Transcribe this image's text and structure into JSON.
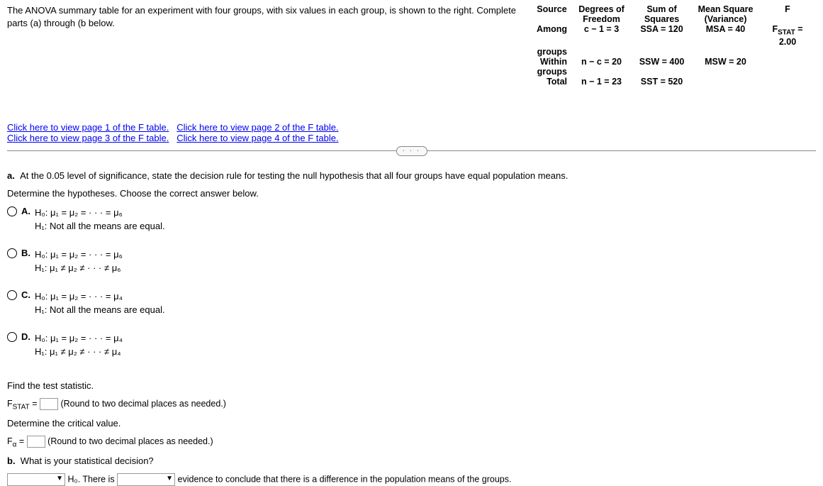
{
  "problem": {
    "intro": "The ANOVA summary table for an experiment with four groups, with six values in each group, is shown to the right. Complete parts (a) through (b below."
  },
  "anova": {
    "headers": {
      "source": "Source",
      "df": "Degrees of Freedom",
      "ss": "Sum of Squares",
      "ms": "Mean Square (Variance)",
      "f": "F"
    },
    "rows": {
      "among": {
        "src1": "Among",
        "src2": "groups",
        "df": "c − 1 = 3",
        "ss": "SSA = 120",
        "ms": "MSA = 40",
        "f_pre": "F",
        "f_sub": "STAT",
        "f_post": " = 2.00"
      },
      "within": {
        "src1": "Within",
        "src2": "groups",
        "df": "n − c = 20",
        "ss": "SSW = 400",
        "ms": "MSW = 20"
      },
      "total": {
        "src": "Total",
        "df": "n − 1 = 23",
        "ss": "SST = 520"
      }
    }
  },
  "links": {
    "p1": "Click here to view page 1 of the F table.",
    "p2": "Click here to view page 2 of the F table.",
    "p3": "Click here to view page 3 of the F table.",
    "p4": "Click here to view page 4 of the F table."
  },
  "dots": "· · ·",
  "partA": {
    "header": "At the 0.05 level of significance, state the decision rule for testing the null hypothesis that all four groups have equal population means.",
    "prompt": "Determine the hypotheses. Choose the correct answer below.",
    "options": {
      "A": {
        "letter": "A.",
        "l1": "H₀: μ₁ = μ₂ = · · · = μ₆",
        "l2": "H₁: Not all the means are equal."
      },
      "B": {
        "letter": "B.",
        "l1": "H₀: μ₁ = μ₂ = · · · = μ₆",
        "l2": "H₁: μ₁ ≠ μ₂ ≠ · · · ≠ μ₆"
      },
      "C": {
        "letter": "C.",
        "l1": "H₀: μ₁ = μ₂ = · · · = μ₄",
        "l2": "H₁: Not all the means are equal."
      },
      "D": {
        "letter": "D.",
        "l1": "H₀: μ₁ = μ₂ = · · · = μ₄",
        "l2": "H₁: μ₁ ≠ μ₂ ≠ · · · ≠ μ₄"
      }
    }
  },
  "findStat": "Find the test statistic.",
  "fstat": {
    "pre": "F",
    "sub": "STAT",
    "post": " = ",
    "hint": " (Round to two decimal places as needed.)"
  },
  "detCrit": "Determine the critical value.",
  "falpha": {
    "pre": "F",
    "sub": "α",
    "post": " = ",
    "hint": " (Round to two decimal places as needed.)"
  },
  "partB": {
    "label": "b.",
    "text": "What is your statistical decision?",
    "mid1": " H₀. There is ",
    "mid2": " evidence to conclude that there is a difference in the population means of the groups."
  },
  "partA_label": "a."
}
